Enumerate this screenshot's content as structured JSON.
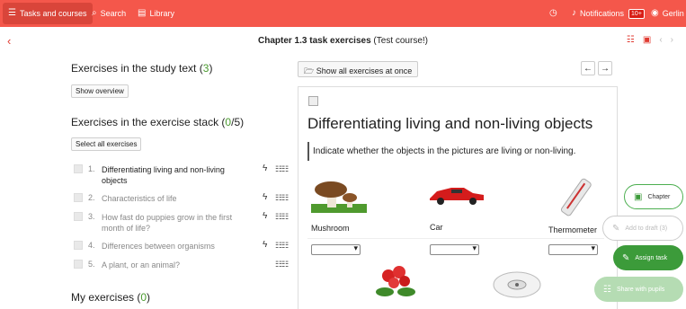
{
  "topbar": {
    "tasks_label": "Tasks and courses",
    "search_label": "Search",
    "library_label": "Library",
    "notifications_label": "Notifications",
    "notifications_count": "10+",
    "user_label": "Gerlin"
  },
  "header": {
    "title_bold": "Chapter 1.3 task exercises",
    "title_rest": "(Test course!)"
  },
  "study_text": {
    "heading": "Exercises in the study text",
    "count": "3",
    "button": "Show overview"
  },
  "exercise_stack": {
    "heading": "Exercises in the exercise stack",
    "done": "0",
    "total": "5",
    "button": "Select all exercises",
    "items": [
      {
        "num": "1.",
        "label": "Differentiating living and non-living objects"
      },
      {
        "num": "2.",
        "label": "Characteristics of life"
      },
      {
        "num": "3.",
        "label": "How fast do puppies grow in the first month of life?"
      },
      {
        "num": "4.",
        "label": "Differences between organisms"
      },
      {
        "num": "5.",
        "label": "A plant, or an animal?"
      }
    ]
  },
  "my_exercises": {
    "heading": "My exercises",
    "count": "0"
  },
  "viewer": {
    "show_all": "Show all exercises at once",
    "title": "Differentiating living and non-living objects",
    "instruction": "Indicate whether the objects in the pictures are living or non-living.",
    "objects": [
      "Mushroom",
      "Car",
      "Thermometer"
    ]
  },
  "fab": {
    "chapter": "Chapter",
    "add_draft": "Add to draft (3)",
    "assign": "Assign task",
    "share": "Share with pupils"
  },
  "colors": {
    "accent": "#f4574b",
    "green": "#3c9b3a"
  }
}
